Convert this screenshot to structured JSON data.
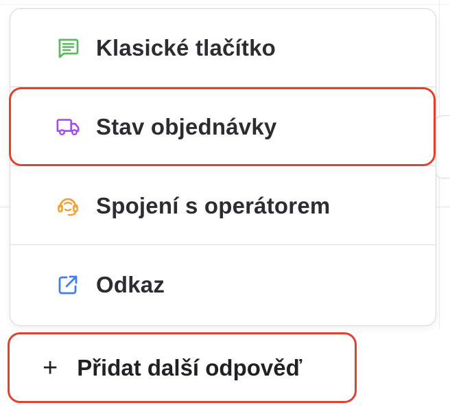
{
  "menu": {
    "items": [
      {
        "label": "Klasické tlačítko",
        "icon": "message-icon",
        "icon_color": "#5cb85c"
      },
      {
        "label": "Stav objednávky",
        "icon": "truck-icon",
        "icon_color": "#a24df0"
      },
      {
        "label": "Spojení s operátorem",
        "icon": "headset-icon",
        "icon_color": "#f0a23a"
      },
      {
        "label": "Odkaz",
        "icon": "external-link-icon",
        "icon_color": "#3f7fe8"
      }
    ]
  },
  "add_button": {
    "icon": "plus-icon",
    "plus": "+",
    "label": "Přidat další odpověď"
  },
  "colors": {
    "highlight": "#e0412c",
    "border": "#d6d8dd",
    "text": "#2b2d33"
  }
}
